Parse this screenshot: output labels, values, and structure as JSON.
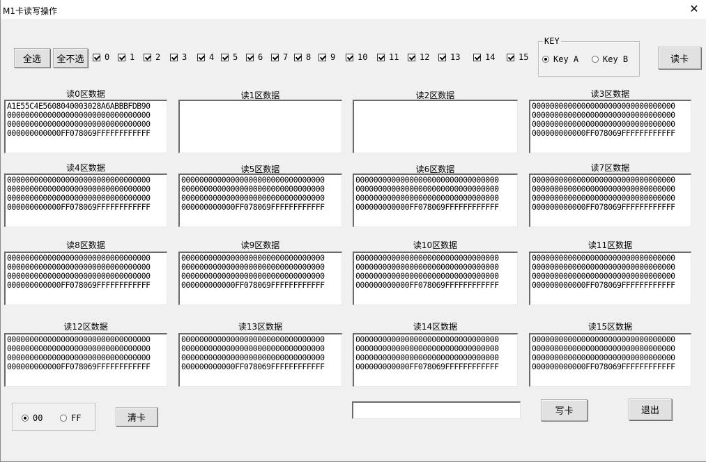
{
  "window": {
    "title": "M1卡读写操作",
    "close_glyph": "✕"
  },
  "toolbar": {
    "select_all": "全选",
    "select_none": "全不选",
    "checkboxes": [
      "0",
      "1",
      "2",
      "3",
      "4",
      "5",
      "6",
      "7",
      "8",
      "9",
      "10",
      "11",
      "12",
      "13",
      "14",
      "15"
    ],
    "checked": [
      true,
      true,
      true,
      true,
      true,
      true,
      true,
      true,
      true,
      true,
      true,
      true,
      true,
      true,
      true,
      true
    ]
  },
  "key_group": {
    "legend": "KEY",
    "options": [
      "Key A",
      "Key B"
    ],
    "selected": "Key A"
  },
  "read_button": "读卡",
  "sectors": [
    {
      "label": "读0区数据",
      "lines": [
        "A1E55C4E5608040003028A6ABBBFDB90",
        "00000000000000000000000000000000",
        "00000000000000000000000000000000",
        "000000000000FF078069FFFFFFFFFFFF"
      ]
    },
    {
      "label": "读1区数据",
      "lines": []
    },
    {
      "label": "读2区数据",
      "lines": []
    },
    {
      "label": "读3区数据",
      "lines": [
        "00000000000000000000000000000000",
        "00000000000000000000000000000000",
        "00000000000000000000000000000000",
        "000000000000FF078069FFFFFFFFFFFF"
      ]
    },
    {
      "label": "读4区数据",
      "lines": [
        "00000000000000000000000000000000",
        "00000000000000000000000000000000",
        "00000000000000000000000000000000",
        "000000000000FF078069FFFFFFFFFFFF"
      ]
    },
    {
      "label": "读5区数据",
      "lines": [
        "00000000000000000000000000000000",
        "00000000000000000000000000000000",
        "00000000000000000000000000000000",
        "000000000000FF078069FFFFFFFFFFFF"
      ]
    },
    {
      "label": "读6区数据",
      "lines": [
        "00000000000000000000000000000000",
        "00000000000000000000000000000000",
        "00000000000000000000000000000000",
        "000000000000FF078069FFFFFFFFFFFF"
      ]
    },
    {
      "label": "读7区数据",
      "lines": [
        "00000000000000000000000000000000",
        "00000000000000000000000000000000",
        "00000000000000000000000000000000",
        "000000000000FF078069FFFFFFFFFFFF"
      ]
    },
    {
      "label": "读8区数据",
      "lines": [
        "00000000000000000000000000000000",
        "00000000000000000000000000000000",
        "00000000000000000000000000000000",
        "000000000000FF078069FFFFFFFFFFFF"
      ]
    },
    {
      "label": "读9区数据",
      "lines": [
        "00000000000000000000000000000000",
        "00000000000000000000000000000000",
        "00000000000000000000000000000000",
        "000000000000FF078069FFFFFFFFFFFF"
      ]
    },
    {
      "label": "读10区数据",
      "lines": [
        "00000000000000000000000000000000",
        "00000000000000000000000000000000",
        "00000000000000000000000000000000",
        "000000000000FF078069FFFFFFFFFFFF"
      ]
    },
    {
      "label": "读11区数据",
      "lines": [
        "00000000000000000000000000000000",
        "00000000000000000000000000000000",
        "00000000000000000000000000000000",
        "000000000000FF078069FFFFFFFFFFFF"
      ]
    },
    {
      "label": "读12区数据",
      "lines": [
        "00000000000000000000000000000000",
        "00000000000000000000000000000000",
        "00000000000000000000000000000000",
        "000000000000FF078069FFFFFFFFFFFF"
      ]
    },
    {
      "label": "读13区数据",
      "lines": [
        "00000000000000000000000000000000",
        "00000000000000000000000000000000",
        "00000000000000000000000000000000",
        "000000000000FF078069FFFFFFFFFFFF"
      ]
    },
    {
      "label": "读14区数据",
      "lines": [
        "00000000000000000000000000000000",
        "00000000000000000000000000000000",
        "00000000000000000000000000000000",
        "000000000000FF078069FFFFFFFFFFFF"
      ]
    },
    {
      "label": "读15区数据",
      "lines": [
        "00000000000000000000000000000000",
        "00000000000000000000000000000000",
        "00000000000000000000000000000000",
        "000000000000FF078069FFFFFFFFFFFF"
      ]
    }
  ],
  "fill_group": {
    "options": [
      "00",
      "FF"
    ],
    "selected": "00"
  },
  "clear_button": "清卡",
  "write_input": {
    "value": "",
    "placeholder": ""
  },
  "write_button": "写卡",
  "exit_button": "退出"
}
